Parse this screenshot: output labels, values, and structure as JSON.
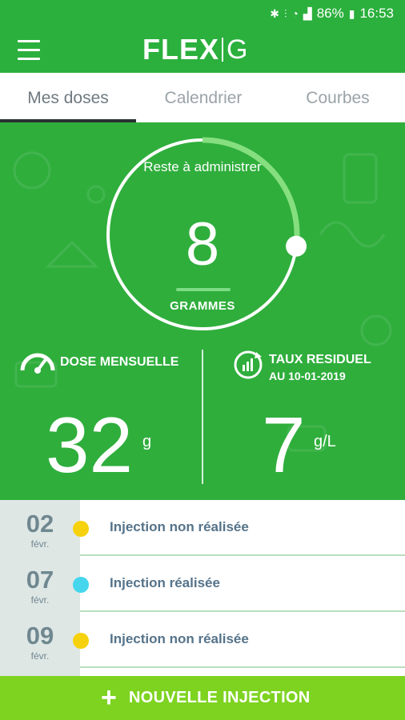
{
  "status_bar": {
    "battery": "86%",
    "time": "16:53",
    "icons": [
      "bluetooth-icon",
      "vibrate-icon",
      "wifi-icon",
      "signal-icon",
      "battery-icon"
    ]
  },
  "app_bar": {
    "logo_bold": "FLEX",
    "logo_thin": "G",
    "menu_icon": "hamburger-icon"
  },
  "tabs": [
    {
      "label": "Mes doses",
      "active": true
    },
    {
      "label": "Calendrier",
      "active": false
    },
    {
      "label": "Courbes",
      "active": false
    }
  ],
  "ring": {
    "title": "Reste à administrer",
    "value": "8",
    "unit": "GRAMMES",
    "progress_fraction": 0.27
  },
  "dose_mensuelle": {
    "label": "DOSE MENSUELLE",
    "value": "32",
    "unit": "g",
    "icon": "gauge-icon"
  },
  "taux_residuel": {
    "label_line1": "TAUX RESIDUEL",
    "label_line2_prefix": "AU",
    "label_date": "10-01-2019",
    "value": "7",
    "unit": "g/L",
    "icon": "chart-refresh-icon"
  },
  "injections": [
    {
      "day": "02",
      "month": "févr.",
      "status": "Injection non réalisée",
      "dot_color": "#f5d20d"
    },
    {
      "day": "07",
      "month": "févr.",
      "status": "Injection réalisée",
      "dot_color": "#45d6ee"
    },
    {
      "day": "09",
      "month": "févr.",
      "status": "Injection non réalisée",
      "dot_color": "#f5d20d"
    }
  ],
  "cta": {
    "label": "NOUVELLE INJECTION",
    "icon": "plus-icon"
  },
  "colors": {
    "primary": "#2bb03d",
    "cta": "#7ed321"
  }
}
